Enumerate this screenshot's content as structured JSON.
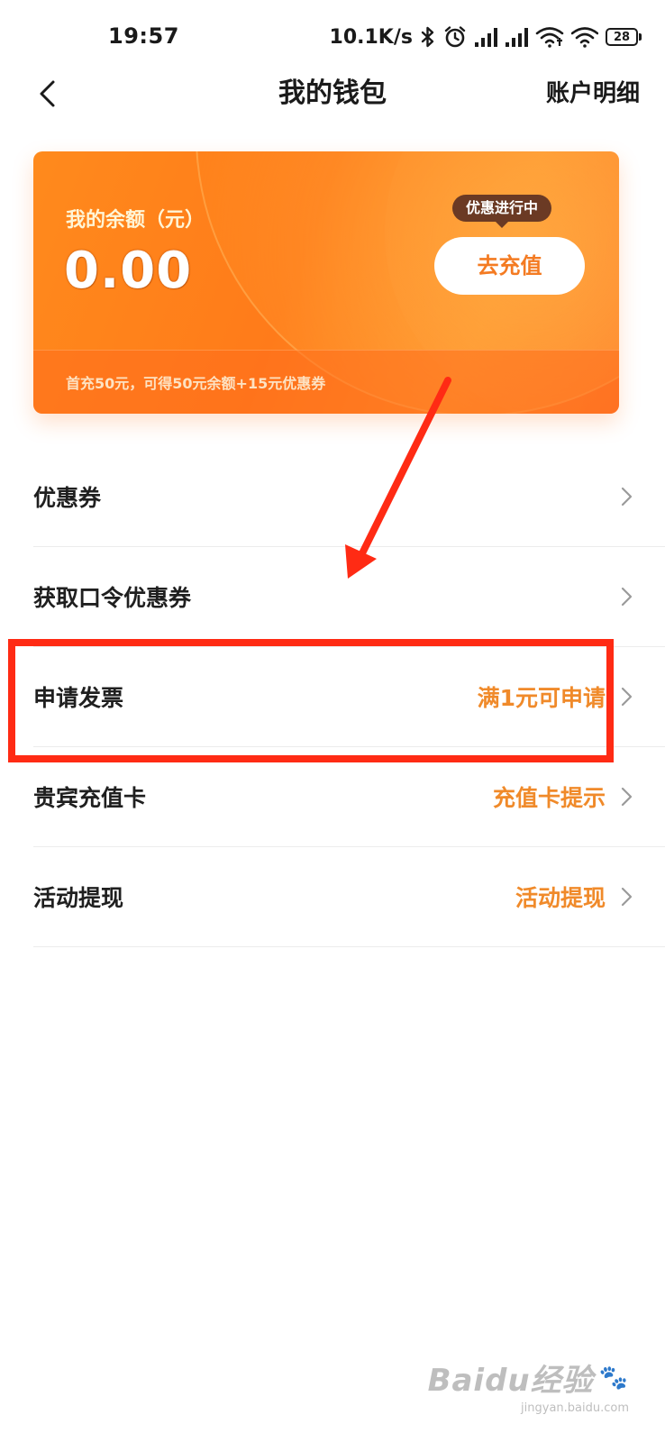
{
  "status_bar": {
    "time": "19:57",
    "network_speed": "10.1K/s",
    "battery_level": "28"
  },
  "nav": {
    "title": "我的钱包",
    "action_label": "账户明细"
  },
  "wallet": {
    "balance_label": "我的余额（元）",
    "balance_value": "0.00",
    "promo_tag": "优惠进行中",
    "recharge_label": "去充值",
    "footer_text": "首充50元，可得50元余额+15元优惠券"
  },
  "menu": {
    "items": [
      {
        "label": "优惠券",
        "hint": ""
      },
      {
        "label": "获取口令优惠券",
        "hint": ""
      },
      {
        "label": "申请发票",
        "hint": "满1元可申请"
      },
      {
        "label": "贵宾充值卡",
        "hint": "充值卡提示"
      },
      {
        "label": "活动提现",
        "hint": "活动提现"
      }
    ]
  },
  "watermark": {
    "brand": "Baidu经验",
    "site": "jingyan.baidu.com"
  },
  "colors": {
    "card_orange": "#ff7b1a",
    "hint_orange": "#f08a2a",
    "annotation_red": "#ff2b14",
    "promo_tag_brown": "#6b3a24"
  }
}
